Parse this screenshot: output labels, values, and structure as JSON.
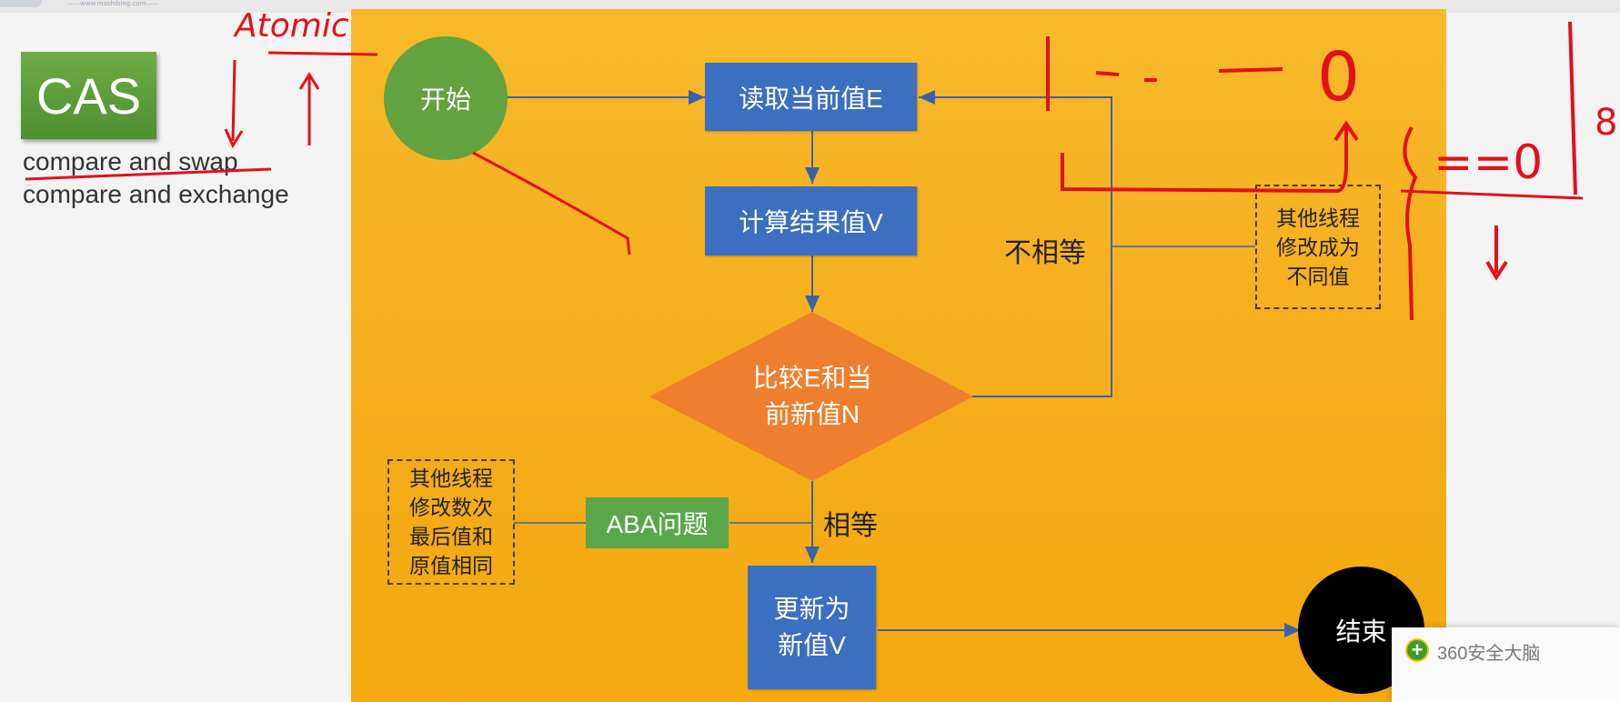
{
  "header": {
    "watermark": "——www.mashibing.com——"
  },
  "left": {
    "title": "CAS",
    "line1": "compare and swap",
    "line2": "compare and exchange"
  },
  "flow": {
    "start": "开始",
    "read": "读取当前值E",
    "compute": "计算结果值V",
    "compare": "比较E和当\n前新值N",
    "update": "更新为\n新值V",
    "end": "结束",
    "not_equal": "不相等",
    "equal": "相等",
    "aba": "ABA问题",
    "note_right": "其他线程\n修改成为\n不同值",
    "note_left": "其他线程\n修改数次\n最后值和\n原值相同"
  },
  "annotation": {
    "word": "Atomic",
    "scribble_zero": "0",
    "scribble_eq": "==0",
    "scribble_eight": "8"
  },
  "colors": {
    "slide_bg": "#f5b01f",
    "box_blue": "#3c6fc0",
    "start_green": "#62a23f",
    "diamond_orange": "#ee7f2e",
    "end_black": "#000000",
    "ink_red": "#e3101a"
  },
  "notification": {
    "text": "360安全大脑",
    "icon": "plus-shield-icon"
  }
}
